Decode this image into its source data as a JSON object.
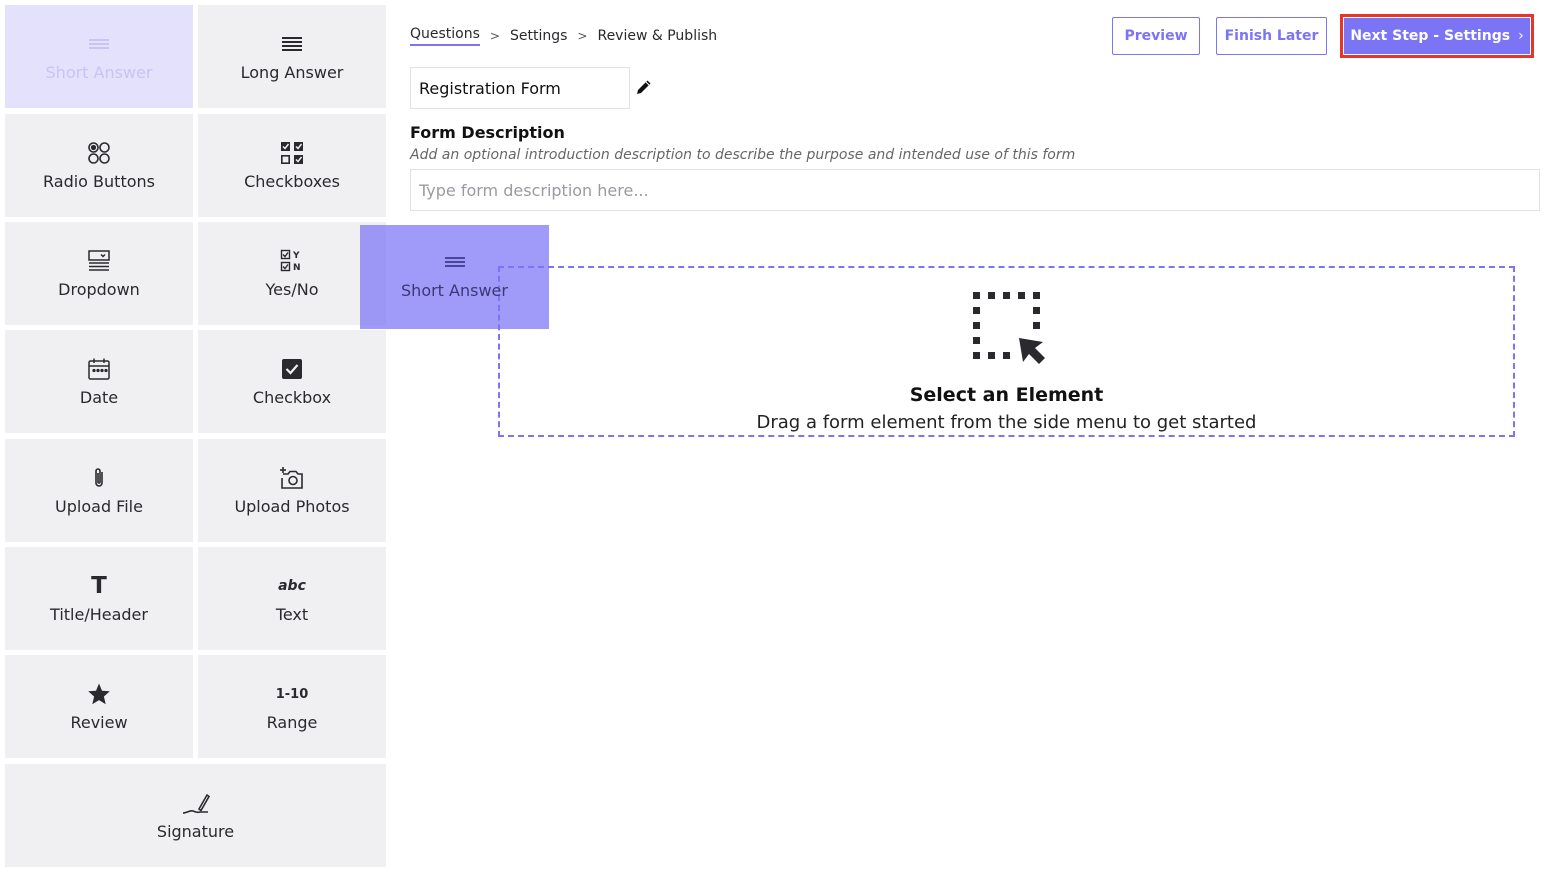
{
  "sidebar": {
    "items": [
      {
        "label": "Short Answer",
        "icon": "short-answer-icon"
      },
      {
        "label": "Long Answer",
        "icon": "long-answer-icon"
      },
      {
        "label": "Radio Buttons",
        "icon": "radio-buttons-icon"
      },
      {
        "label": "Checkboxes",
        "icon": "checkboxes-icon"
      },
      {
        "label": "Dropdown",
        "icon": "dropdown-icon"
      },
      {
        "label": "Yes/No",
        "icon": "yes-no-icon"
      },
      {
        "label": "Date",
        "icon": "calendar-icon"
      },
      {
        "label": "Checkbox",
        "icon": "checkbox-icon"
      },
      {
        "label": "Upload File",
        "icon": "paperclip-icon"
      },
      {
        "label": "Upload Photos",
        "icon": "camera-plus-icon"
      },
      {
        "label": "Title/Header",
        "icon": "title-t-icon"
      },
      {
        "label": "Text",
        "icon": "text-abc-icon"
      },
      {
        "label": "Review",
        "icon": "star-icon"
      },
      {
        "label": "Range",
        "icon": "range-icon",
        "glyph": "1-10"
      },
      {
        "label": "Signature",
        "icon": "signature-icon"
      }
    ],
    "text_icon_glyph": "abc",
    "title_icon_glyph": "T",
    "yes_no_glyph_y": "Y",
    "yes_no_glyph_n": "N"
  },
  "breadcrumb": {
    "steps": [
      "Questions",
      "Settings",
      "Review & Publish"
    ],
    "separator": ">"
  },
  "toolbar": {
    "preview_label": "Preview",
    "finish_later_label": "Finish Later",
    "next_label": "Next Step - Settings",
    "next_chevron": "›"
  },
  "form": {
    "title": "Registration Form",
    "description_heading": "Form Description",
    "description_hint": "Add an optional introduction description to describe the purpose and intended use of this form",
    "description_placeholder": "Type form description here..."
  },
  "dropzone": {
    "title": "Select an Element",
    "subtitle": "Drag a form element from the side menu to get started"
  },
  "drag_ghost": {
    "label": "Short Answer"
  },
  "colors": {
    "accent": "#7b74f5",
    "highlight_border": "#e8352a",
    "tile_bg": "#f0f0f3"
  }
}
